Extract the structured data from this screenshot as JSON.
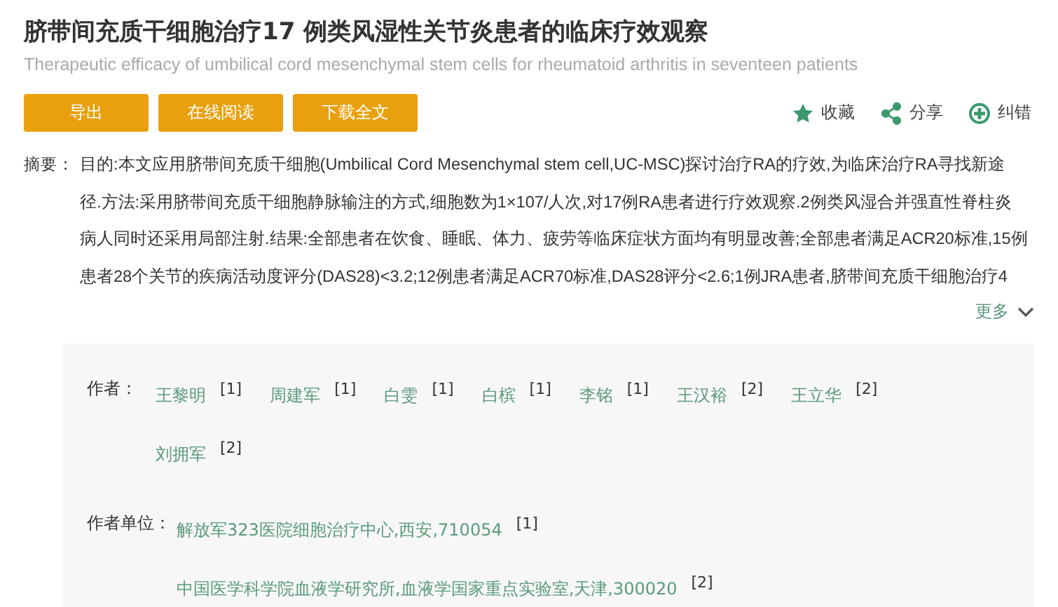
{
  "title": "脐带间充质干细胞治疗17 例类风湿性关节炎患者的临床疗效观察",
  "subtitle": "Therapeutic efficacy of umbilical cord mesenchymal stem cells for rheumatoid arthritis in seventeen patients",
  "buttons": [
    "导出",
    "在线阅读",
    "下载全文"
  ],
  "actions": [
    {
      "kind": "star",
      "label": "收藏"
    },
    {
      "kind": "share",
      "label": "分享"
    },
    {
      "kind": "correct",
      "label": "纠错"
    }
  ],
  "abstract": {
    "label": "摘要：",
    "lines": [
      "目的:本文应用脐带间充质干细胞(Umbilical Cord Mesenchymal stem cell,UC-MSC)探讨治疗RA的疗效,为临床治疗RA寻找新途",
      "径.方法:采用脐带间充质干细胞静脉输注的方式,细胞数为1×107/人次,对17例RA患者进行疗效观察.2例类风湿合并强直性脊柱炎",
      "病人同时还采用局部注射.结果:全部患者在饮食、睡眠、体力、疲劳等临床症状方面均有明显改善;全部患者满足ACR20标准,15例",
      "患者28个关节的疾病活动度评分(DAS28)<3.2;12例患者满足ACR70标准,DAS28评分<2.6;1例JRA患者,脐带间充质干细胞治疗4"
    ],
    "more": "更多"
  },
  "authors": {
    "label": "作者：",
    "items": [
      {
        "name": "王黎明",
        "ref": "[1]"
      },
      {
        "name": "周建军",
        "ref": "[1]"
      },
      {
        "name": "白雯",
        "ref": "[1]"
      },
      {
        "name": "白槟",
        "ref": "[1]"
      },
      {
        "name": "李铭",
        "ref": "[1]"
      },
      {
        "name": "王汉裕",
        "ref": "[2]"
      },
      {
        "name": "王立华",
        "ref": "[2]"
      },
      {
        "name": "刘拥军",
        "ref": "[2]"
      }
    ]
  },
  "affiliations": {
    "label": "作者单位：",
    "items": [
      {
        "name": "解放军323医院细胞治疗中心,西安,710054",
        "ref": "[1]"
      },
      {
        "name": "中国医学科学院血液学研究所,血液学国家重点实验室,天津,300020",
        "ref": "[2]"
      }
    ]
  }
}
